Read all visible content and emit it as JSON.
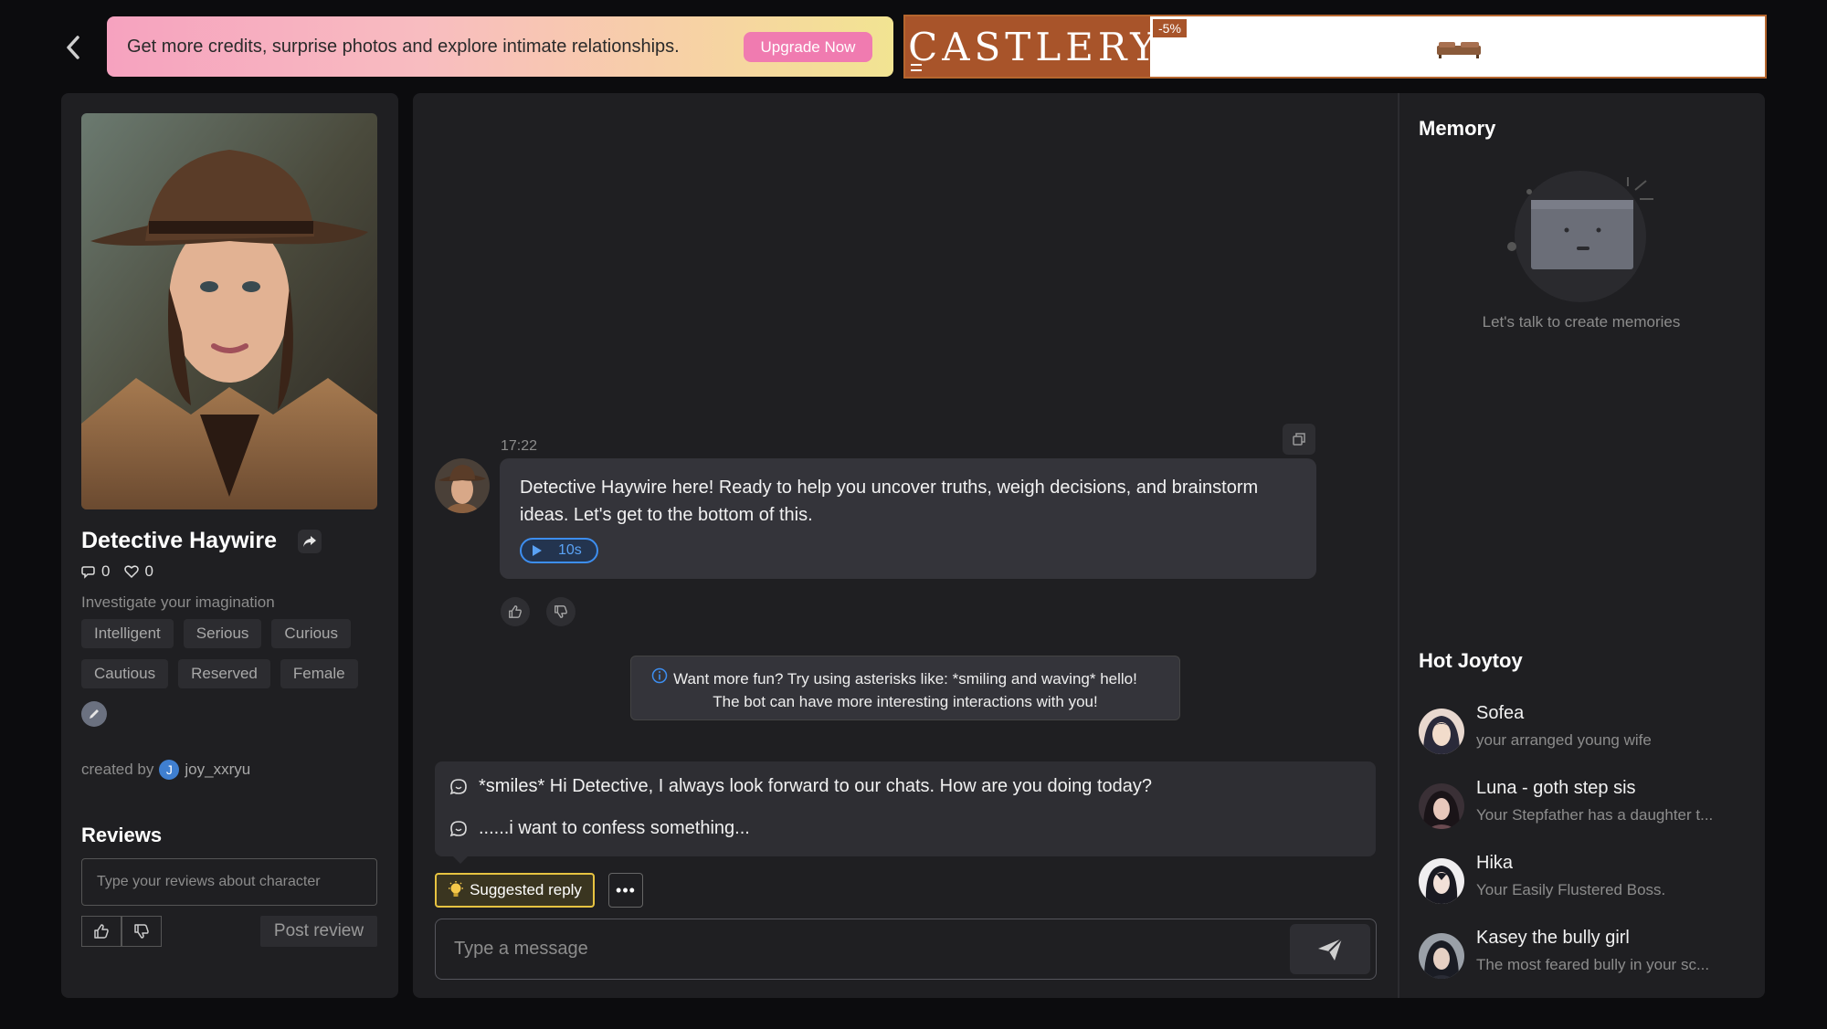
{
  "promo": {
    "text": "Get more credits, surprise photos and explore intimate relationships.",
    "cta": "Upgrade Now"
  },
  "ad": {
    "brand": "CASTLERY",
    "badge": "-5%",
    "color": "#a8542a"
  },
  "character": {
    "name": "Detective Haywire",
    "chats": "0",
    "likes": "0",
    "description": "Investigate your imagination",
    "tags": [
      "Intelligent",
      "Serious",
      "Curious",
      "Cautious",
      "Reserved",
      "Female"
    ],
    "created_by_label": "created by",
    "creator_initial": "J",
    "creator_name": "joy_xxryu"
  },
  "reviews": {
    "title": "Reviews",
    "placeholder": "Type your reviews about character",
    "post_label": "Post review"
  },
  "chat": {
    "message_time": "17:22",
    "message_text": "Detective Haywire here! Ready to help you uncover truths, weigh decisions, and brainstorm ideas. Let's get to the bottom of this.",
    "audio_duration": "10s",
    "tip_line1": "Want more fun? Try using asterisks like: *smiling and waving* hello!",
    "tip_line2": "The bot can have more interesting interactions with you!",
    "suggestions": [
      "*smiles* Hi Detective, I always look forward to our chats. How are you doing today?",
      "......i want to confess something..."
    ],
    "suggest_label": "Suggested reply",
    "more_label": "•••",
    "input_placeholder": "Type a message"
  },
  "memory": {
    "title": "Memory",
    "empty_text": "Let's talk to create memories"
  },
  "hot": {
    "title": "Hot Joytoy",
    "items": [
      {
        "name": "Sofea",
        "desc": "your arranged young wife"
      },
      {
        "name": "Luna - goth step sis",
        "desc": "Your Stepfather has a daughter t..."
      },
      {
        "name": "Hika",
        "desc": "Your Easily Flustered Boss."
      },
      {
        "name": "Kasey the bully girl",
        "desc": "The most feared bully in your sc..."
      }
    ]
  },
  "colors": {
    "accent_blue": "#3d8ef0",
    "suggest_border": "#e7c341",
    "upgrade_pink": "#f07bb0"
  }
}
